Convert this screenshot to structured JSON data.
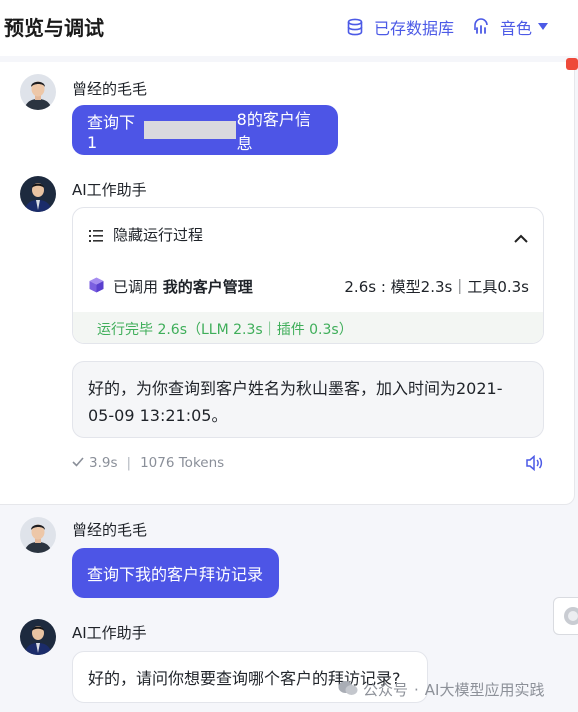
{
  "header": {
    "title": "预览与调试",
    "knowledge_base_label": "已存数据库",
    "voice_label": "音色"
  },
  "conversation": [
    {
      "role": "user",
      "name": "曾经的毛毛",
      "text_prefix": "查询下1",
      "text_suffix": "8的客户信息"
    },
    {
      "role": "assistant",
      "name": "AI工作助手",
      "process": {
        "toggle_label": "隐藏运行过程",
        "called_prefix": "已调用",
        "tool_name": "我的客户管理",
        "timing": "2.6s : 模型2.3s｜工具0.3s",
        "done_text": "运行完毕 2.6s（LLM 2.3s｜插件 0.3s）"
      },
      "text": "好的，为你查询到客户姓名为秋山墨客，加入时间为2021-05-09 13:21:05。",
      "meta": {
        "duration": "3.9s",
        "tokens": "1076 Tokens"
      }
    },
    {
      "role": "user",
      "name": "曾经的毛毛",
      "text": "查询下我的客户拜访记录"
    },
    {
      "role": "assistant",
      "name": "AI工作助手",
      "text": "好的，请问你想要查询哪个客户的拜访记录?"
    }
  ],
  "watermark": {
    "source": "公众号",
    "separator": "·",
    "account": "AI大模型应用实践"
  },
  "colors": {
    "accent": "#4d55e6",
    "success": "#3fae5a",
    "badge": "#ee4a3a"
  },
  "icons": [
    "database-icon",
    "voice-icon",
    "list-icon",
    "chevron-up-icon",
    "cube-icon",
    "check-icon",
    "speaker-icon",
    "wechat-icon"
  ]
}
